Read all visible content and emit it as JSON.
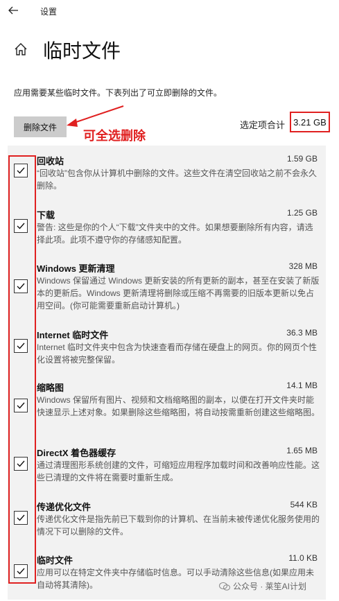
{
  "titlebar": {
    "app_title": "设置"
  },
  "page": {
    "title": "临时文件",
    "description": "应用需要某些临时文件。下表列出了可立即删除的文件。"
  },
  "toolbar": {
    "delete_label": "删除文件",
    "annotation": "可全选删除",
    "total_label": "选定项合计",
    "total_value": "3.21 GB"
  },
  "items": [
    {
      "title": "回收站",
      "size": "1.59 GB",
      "checked": true,
      "desc": "“回收站”包含你从计算机中删除的文件。这些文件在清空回收站之前不会永久删除。"
    },
    {
      "title": "下载",
      "size": "1.25 GB",
      "checked": true,
      "desc": "警告: 这些是你的个人“下载”文件夹中的文件。如果想要删除所有内容，请选择此项。此项不遵守你的存储感知配置。"
    },
    {
      "title": "Windows 更新清理",
      "size": "328 MB",
      "checked": true,
      "desc": "Windows 保留通过 Windows 更新安装的所有更新的副本，甚至在安装了新版本的更新后。Windows 更新清理将删除或压缩不再需要的旧版本更新以免占用空间。(你可能需要重新启动计算机。)"
    },
    {
      "title": "Internet 临时文件",
      "size": "36.3 MB",
      "checked": true,
      "desc": "Internet 临时文件夹中包含为快速查看而存储在硬盘上的网页。你的网页个性化设置将被完整保留。"
    },
    {
      "title": "缩略图",
      "size": "14.1 MB",
      "checked": true,
      "desc": "Windows 保留所有图片、视频和文档缩略图的副本，以便在打开文件夹时能快速显示上述对象。如果删除这些缩略图，将自动按需重新创建这些缩略图。"
    },
    {
      "title": "DirectX 着色器缓存",
      "size": "1.65 MB",
      "checked": true,
      "desc": "通过清理图形系统创建的文件，可缩短应用程序加载时间和改善响应性能。这些已清理的文件将在需要时重新生成。"
    },
    {
      "title": "传递优化文件",
      "size": "544 KB",
      "checked": true,
      "desc": "传递优化文件是指先前已下载到你的计算机、在当前未被传递优化服务使用的情况下可以删除的文件。"
    },
    {
      "title": "临时文件",
      "size": "11.0 KB",
      "checked": true,
      "desc": "应用可以在特定文件夹中存储临时信息。可以手动清除这些信息(如果应用未自动将其清除)。"
    }
  ],
  "watermark": {
    "text": "公众号 · 莱笙AI计划"
  },
  "colors": {
    "annotation_red": "#e02020",
    "button_gray": "#cccccc",
    "list_bg": "#f2f2f2"
  }
}
